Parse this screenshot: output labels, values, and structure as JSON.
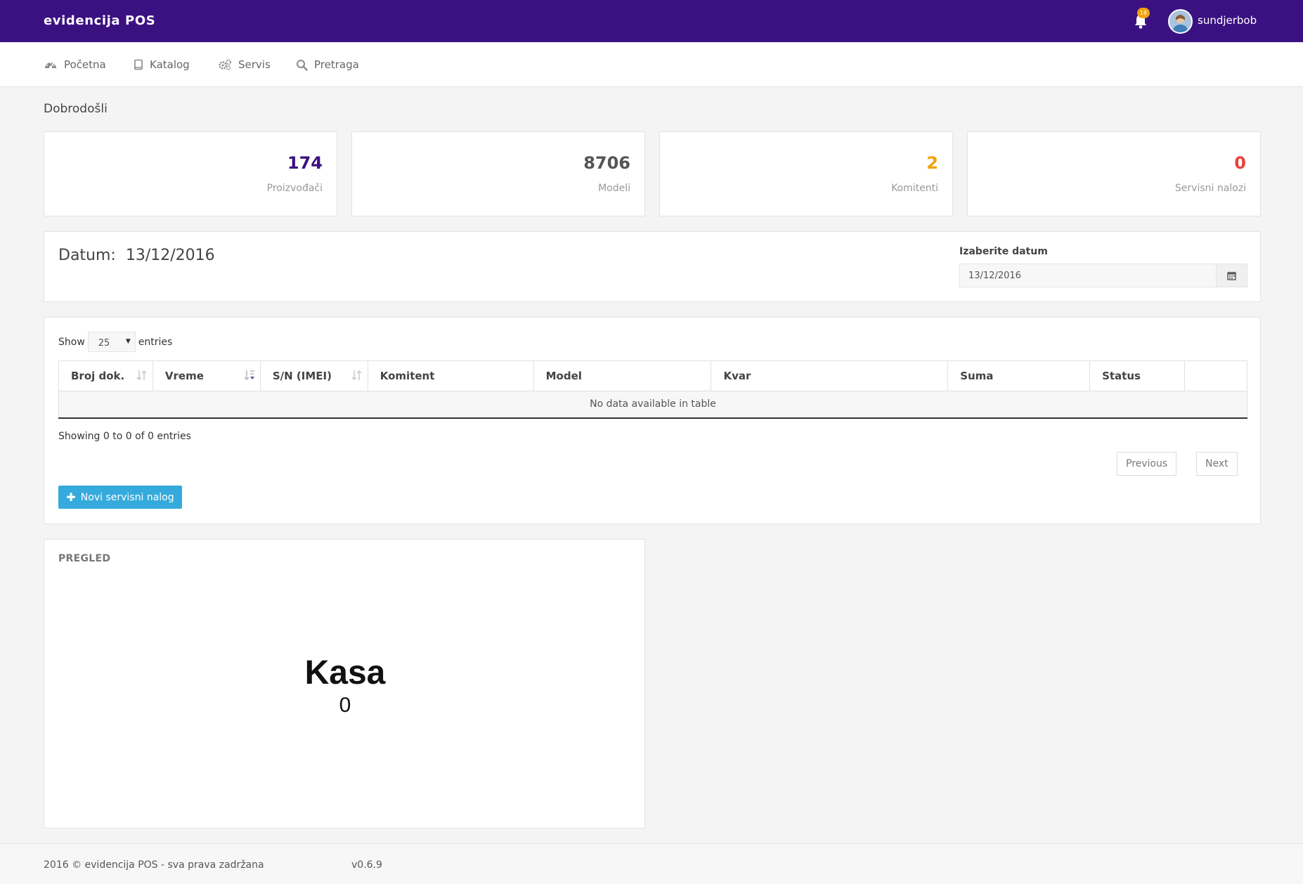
{
  "app": {
    "brand": "evidencija POS",
    "notifications_count": "18",
    "username": "sundjerbob"
  },
  "nav": {
    "items": [
      {
        "label": "Početna",
        "icon": "dashboard-icon"
      },
      {
        "label": "Katalog",
        "icon": "book-icon"
      },
      {
        "label": "Servis",
        "icon": "gears-icon"
      },
      {
        "label": "Pretraga",
        "icon": "search-icon"
      }
    ]
  },
  "welcome": "Dobrodošli",
  "stats": [
    {
      "value": "174",
      "label": "Proizvođači",
      "color": "#3b1182"
    },
    {
      "value": "8706",
      "label": "Modeli",
      "color": "#555555"
    },
    {
      "value": "2",
      "label": "Komitenti",
      "color": "#f0a30a"
    },
    {
      "value": "0",
      "label": "Servisni nalozi",
      "color": "#e8413a"
    }
  ],
  "date_panel": {
    "title_prefix": "Datum:",
    "title_date": "13/12/2016",
    "picker_label": "Izaberite datum",
    "picker_value": "13/12/2016"
  },
  "table": {
    "show_label": "Show",
    "entries_label": "entries",
    "page_length": "25",
    "columns": [
      "Broj dok.",
      "Vreme",
      "S/N (IMEI)",
      "Komitent",
      "Model",
      "Kvar",
      "Suma",
      "Status",
      ""
    ],
    "empty_message": "No data available in table",
    "info": "Showing 0 to 0 of 0 entries",
    "prev_label": "Previous",
    "next_label": "Next",
    "new_button_label": "Novi servisni nalog"
  },
  "overview": {
    "title": "PREGLED",
    "kasa_label": "Kasa",
    "kasa_value": "0"
  },
  "footer": {
    "copyright": "2016 © evidencija POS - sva prava zadržana",
    "version": "v0.6.9"
  },
  "colors": {
    "topbar": "#3b1182",
    "primary_button": "#35aadc",
    "badge": "#f0a30a"
  }
}
